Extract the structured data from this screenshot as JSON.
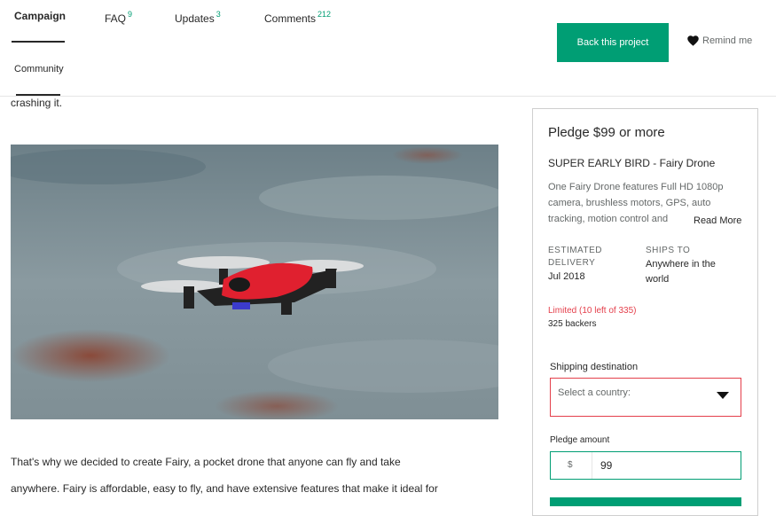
{
  "nav": {
    "tabs": [
      {
        "label": "Campaign",
        "count": ""
      },
      {
        "label": "FAQ",
        "count": "9"
      },
      {
        "label": "Updates",
        "count": "3"
      },
      {
        "label": "Comments",
        "count": "212"
      },
      {
        "label": "Community",
        "count": ""
      }
    ],
    "back_label": "Back this project",
    "remind_label": "Remind me"
  },
  "story": {
    "line0": "crashing it.",
    "line1": "That's why we decided to create Fairy, a pocket drone that anyone can fly and take",
    "line2": "anywhere. Fairy is affordable, easy to fly, and have extensive features that make it ideal for"
  },
  "reward": {
    "pledge_title": "Pledge $99 or more",
    "name": "SUPER EARLY BIRD - Fairy Drone",
    "desc1": "One Fairy Drone features Full HD 1080p",
    "desc2": "camera, brushless motors, GPS, auto",
    "desc3": "tracking, motion control and",
    "read_more": "Read More",
    "est_label1": "ESTIMATED",
    "est_label2": "DELIVERY",
    "est_value": "Jul 2018",
    "ships_label": "SHIPS TO",
    "ships_value1": "Anywhere in the",
    "ships_value2": "world",
    "limited": "Limited (10 left of 335)",
    "backers": "325 backers",
    "shipping_label": "Shipping destination",
    "country_placeholder": "Select a country:",
    "amount_label": "Pledge amount",
    "currency": "$",
    "amount_value": "99"
  },
  "colors": {
    "accent": "#009e74",
    "error": "#e43f4b"
  }
}
